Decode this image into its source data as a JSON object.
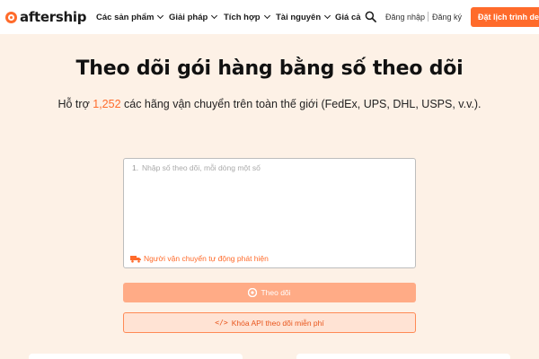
{
  "header": {
    "brand": "aftership",
    "nav": [
      {
        "label": "Các sản phẩm",
        "has_dropdown": true
      },
      {
        "label": "Giải pháp",
        "has_dropdown": true
      },
      {
        "label": "Tích hợp",
        "has_dropdown": true
      },
      {
        "label": "Tài nguyên",
        "has_dropdown": true
      },
      {
        "label": "Giá cả",
        "has_dropdown": false
      }
    ],
    "search_icon": "search-icon",
    "login": "Đăng nhập",
    "signup": "Đăng ký",
    "cta": "Đặt lịch trình demo"
  },
  "main": {
    "title": "Theo dõi gói hàng bằng số theo dõi",
    "subtitle_prefix": "Hỗ trợ ",
    "carrier_count": "1,252",
    "subtitle_suffix": " các hãng vận chuyển trên toàn thế giới (FedEx, UPS, DHL, USPS, v.v.).",
    "textarea": {
      "line_number": "1.",
      "placeholder": "Nhập số theo dõi, mỗi dòng một số",
      "auto_detect": "Người vận chuyển tự động phát hiện"
    },
    "track_button": "Theo dõi",
    "api_button": "Khóa API theo dõi miễn phí"
  },
  "colors": {
    "accent": "#ff6b2b",
    "background": "#fdf1e6",
    "track_button_disabled": "#ffab86"
  }
}
